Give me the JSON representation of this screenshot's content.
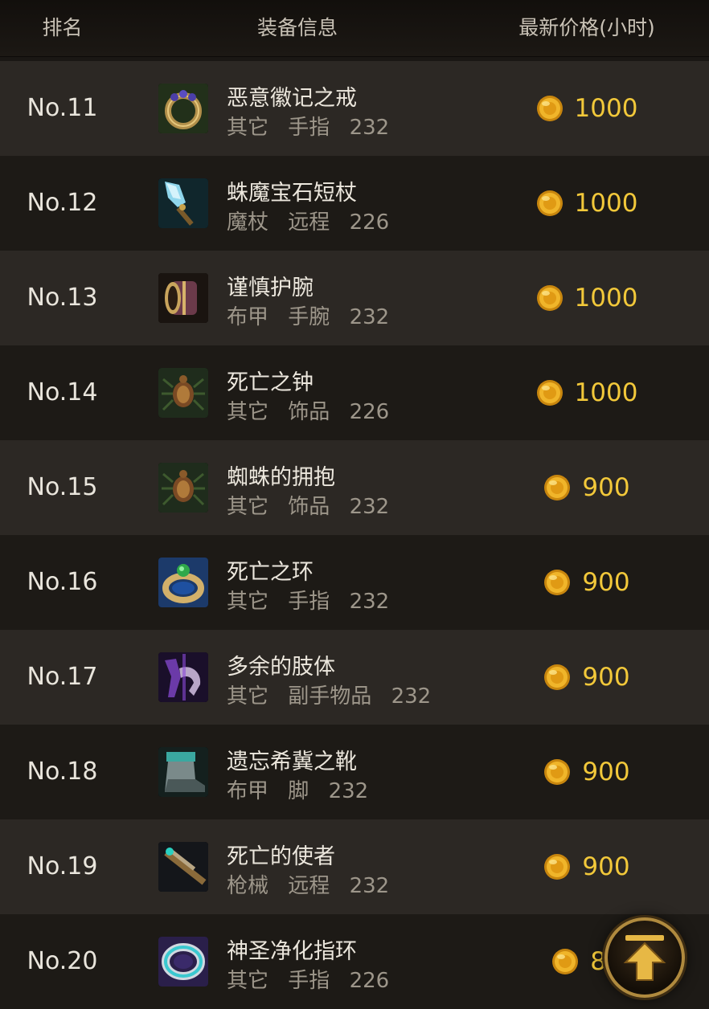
{
  "header": {
    "rank": "排名",
    "info": "装备信息",
    "price": "最新价格(小时)"
  },
  "rows": [
    {
      "rank": "No.11",
      "name": "恶意徽记之戒",
      "category": "其它",
      "slot": "手指",
      "level": "232",
      "price": "1000",
      "icon": "ring-purple-gems-icon"
    },
    {
      "rank": "No.12",
      "name": "蛛魔宝石短杖",
      "category": "魔杖",
      "slot": "远程",
      "level": "226",
      "price": "1000",
      "icon": "crystal-wand-icon"
    },
    {
      "rank": "No.13",
      "name": "谨慎护腕",
      "category": "布甲",
      "slot": "手腕",
      "level": "232",
      "price": "1000",
      "icon": "bracer-icon"
    },
    {
      "rank": "No.14",
      "name": "死亡之钟",
      "category": "其它",
      "slot": "饰品",
      "level": "226",
      "price": "1000",
      "icon": "spider-trinket-icon"
    },
    {
      "rank": "No.15",
      "name": "蜘蛛的拥抱",
      "category": "其它",
      "slot": "饰品",
      "level": "232",
      "price": "900",
      "icon": "spider-trinket-icon"
    },
    {
      "rank": "No.16",
      "name": "死亡之环",
      "category": "其它",
      "slot": "手指",
      "level": "232",
      "price": "900",
      "icon": "ring-green-gem-icon"
    },
    {
      "rank": "No.17",
      "name": "多余的肢体",
      "category": "其它",
      "slot": "副手物品",
      "level": "232",
      "price": "900",
      "icon": "purple-limb-icon"
    },
    {
      "rank": "No.18",
      "name": "遗忘希冀之靴",
      "category": "布甲",
      "slot": "脚",
      "level": "232",
      "price": "900",
      "icon": "boots-icon"
    },
    {
      "rank": "No.19",
      "name": "死亡的使者",
      "category": "枪械",
      "slot": "远程",
      "level": "232",
      "price": "900",
      "icon": "gun-icon"
    },
    {
      "rank": "No.20",
      "name": "神圣净化指环",
      "category": "其它",
      "slot": "手指",
      "level": "226",
      "price": "80",
      "icon": "ring-teal-icon"
    }
  ],
  "colors": {
    "price": "#f2c83a",
    "rank": "#e9e5dc",
    "meta": "#9d968a",
    "row_light": "#2c2824",
    "row_dark": "#1d1a16"
  },
  "scroll_top_icon": "arrow-up-icon",
  "coin_icon": "gold-coin-icon"
}
